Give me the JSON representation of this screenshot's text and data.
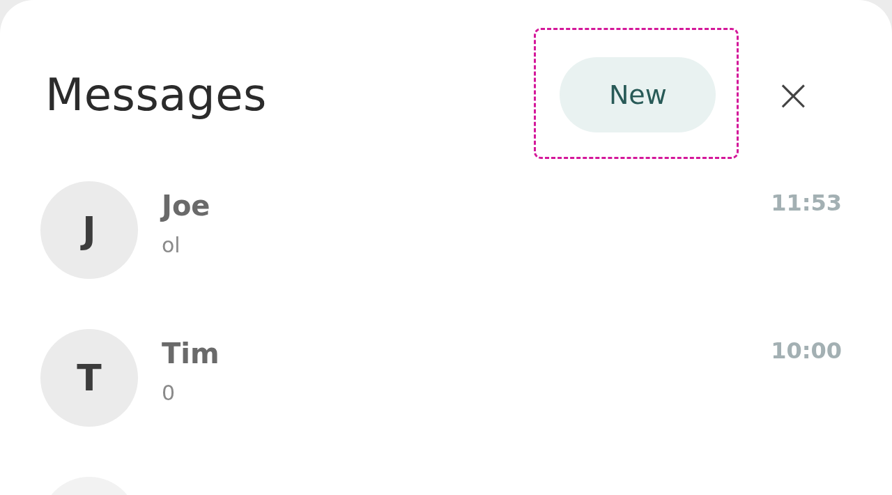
{
  "header": {
    "title": "Messages",
    "new_button": {
      "label": "New",
      "highlighted": true
    },
    "close_icon": "×"
  },
  "conversations": [
    {
      "initial": "J",
      "name": "Joe",
      "preview": "ol",
      "time": "11:53"
    },
    {
      "initial": "T",
      "name": "Tim",
      "preview": "0",
      "time": "10:00"
    }
  ],
  "more_below": true
}
